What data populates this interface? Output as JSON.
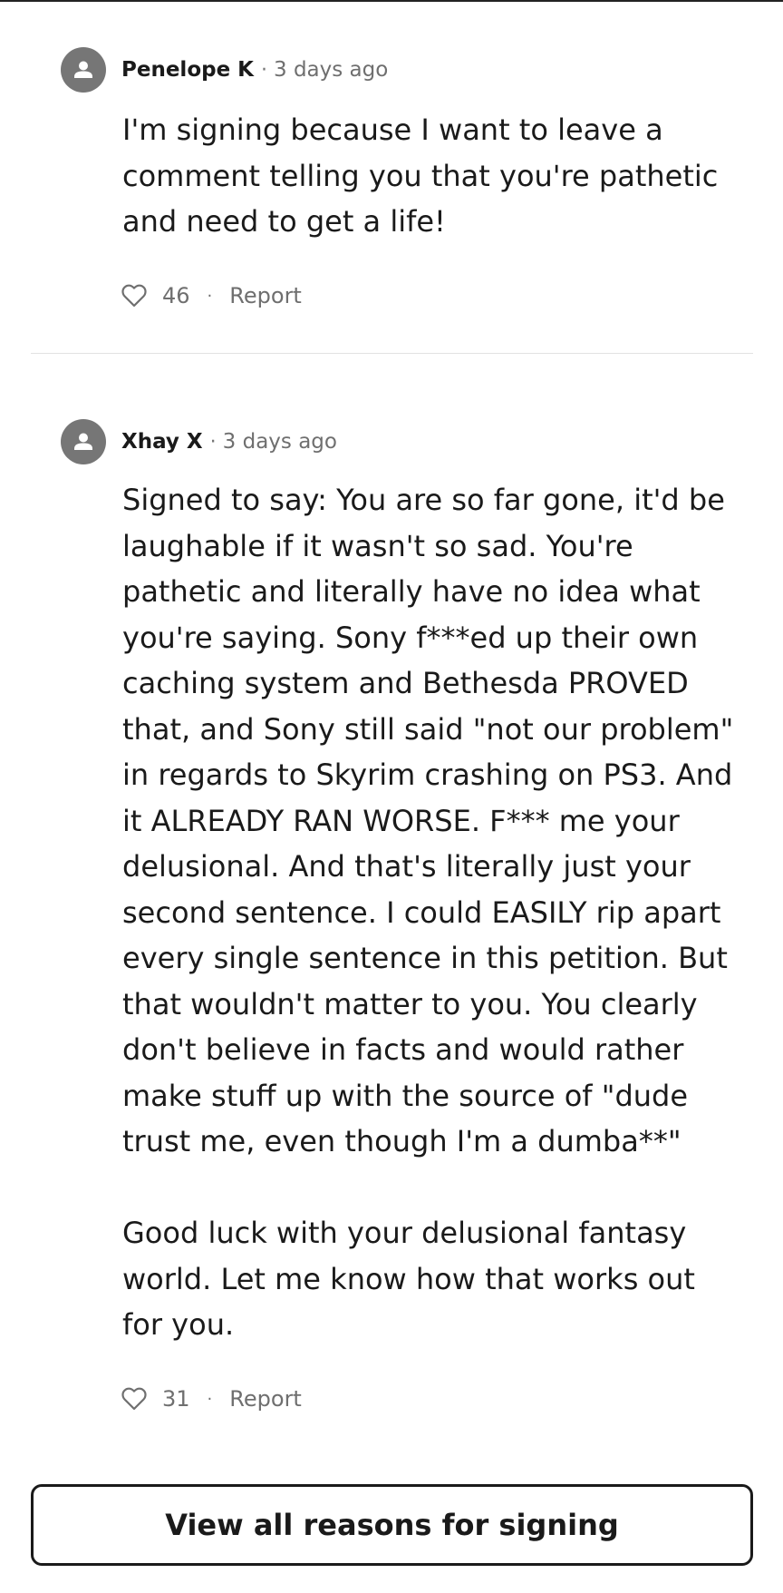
{
  "comments": [
    {
      "author": "Penelope K",
      "separator": "·",
      "time": "3 days ago",
      "body": "I'm signing because I want to leave a comment telling you that you're pathetic and need to get a life!",
      "likes": "46",
      "action_separator": "·",
      "report_label": "Report",
      "avatar_icon": "person-icon",
      "like_icon": "heart-outline-icon"
    },
    {
      "author": "Xhay X",
      "separator": "·",
      "time": "3 days ago",
      "body": "Signed to say: You are so far gone, it'd be laughable if it wasn't so sad. You're pathetic and literally have no idea what you're saying. Sony f***ed up their own caching system and Bethesda PROVED that, and Sony still said \"not our problem\" in regards to Skyrim crashing on PS3. And it ALREADY RAN WORSE. F*** me your delusional. And that's literally just your second sentence. I could EASILY rip apart every single sentence in this petition. But that wouldn't matter to you. You clearly don't believe in facts and would rather make stuff up with the source of \"dude trust me, even though I'm a dumba**\"\n\nGood luck with your delusional fantasy world. Let me know how that works out for you.",
      "likes": "31",
      "action_separator": "·",
      "report_label": "Report",
      "avatar_icon": "person-icon",
      "like_icon": "heart-outline-icon"
    }
  ],
  "view_all_label": "View all reasons for signing",
  "colors": {
    "avatar_bg": "#767676",
    "muted_text": "#6f6f6f",
    "text": "#1a1a1a",
    "divider": "#e2e2e2",
    "button_border": "#1a1a1a"
  }
}
